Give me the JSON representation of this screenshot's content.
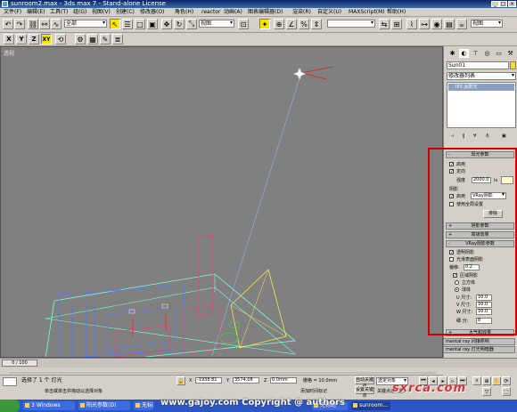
{
  "window": {
    "title": "sunroom2.max - 3ds max 7 - Stand-alone License",
    "min": "_",
    "max": "□",
    "close": "×"
  },
  "menu": [
    "文件(F)",
    "编辑(E)",
    "工具(T)",
    "组(G)",
    "视图(V)",
    "创建(C)",
    "修改器(O)",
    "角色(H)",
    "reactor",
    "动画(A)",
    "图表编辑器(D)",
    "渲染(R)",
    "自定义(U)",
    "MAXScript(M)",
    "帮助(H)"
  ],
  "toolbar": {
    "filter": "全部",
    "ref_coord": "视图",
    "named_sel": "",
    "view_drop": "视图",
    "axes": [
      "X",
      "Y",
      "Z",
      "XY"
    ]
  },
  "viewport": {
    "label": "透视"
  },
  "command_panel": {
    "object_name": "Sun01",
    "modifier_list": "修改器列表",
    "stack_item": "IES 太阳光",
    "roll_sun": "阳光参数",
    "enabled_label": "启用",
    "targeted_label": "定向",
    "intensity_label": "强度",
    "intensity_value": "2000.0",
    "intensity_unit": "lx",
    "color_swatch": "#fff8c8",
    "shadows_label": "阴影",
    "shadow_enabled": "启用",
    "shadow_type": "VRay阴影",
    "global_settings": "使用全局设置",
    "exclude": "排除",
    "roll_shadow_params": "阴影参数",
    "roll_advanced": "高级效果",
    "roll_vray_shadow": "VRay阴影参数",
    "transparent_shadows": "透明阴影",
    "smooth_surface": "光滑表面阴影",
    "bias_label": "偏移:",
    "bias_value": "0.2",
    "area_shadow": "区域阴影",
    "box": "立方体",
    "sphere": "球体",
    "u_size_label": "U 尺寸:",
    "u_size": "10.0",
    "v_size_label": "V 尺寸:",
    "v_size": "10.0",
    "w_size_label": "W 尺寸:",
    "w_size": "10.0",
    "subdivs_label": "细 分:",
    "subdivs": "8",
    "roll_mental_ray_a": "mental ray 间接照明",
    "roll_mental_ray_b": "mental ray 灯光明暗器",
    "roll_atmos": "大气和效果"
  },
  "timeline": {
    "frame": "0 / 100"
  },
  "status": {
    "selected": "选择了 1 个 灯光",
    "prompt": "单击或单击并拖动以选择对象",
    "x_label": "X",
    "x_val": "-1938.81",
    "y_label": "Y",
    "y_val": "3574.08",
    "z_label": "Z",
    "z_val": "0.0mm",
    "grid": "栅格 = 10.0mm",
    "auto_key": "自动关键点",
    "set_key": "设置关键点",
    "key_filter": "选定对象",
    "key_filters": "关键点过滤器...",
    "add_time_tag": "添加时间标记"
  },
  "taskbar": {
    "tasks": [
      "3 Windows",
      "阳光参数(D)",
      "无标题",
      "无标题",
      "sunroom..."
    ]
  },
  "watermark": "www.gajoy.com Copyright @ authors",
  "logo": "sxrca.com",
  "accent_red": "#d40000"
}
